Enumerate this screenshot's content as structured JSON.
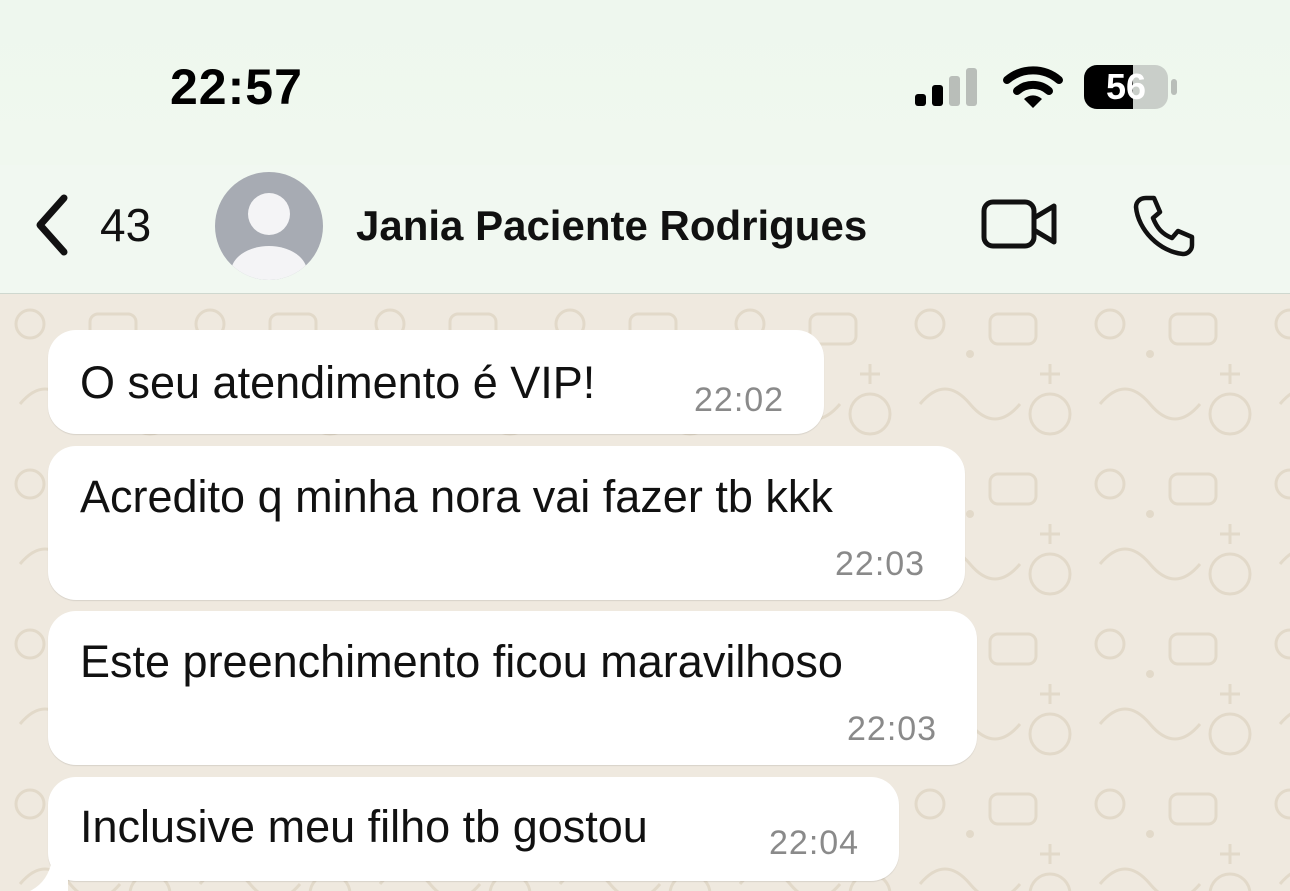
{
  "status_bar": {
    "time": "22:57",
    "battery_level": "56",
    "icons": [
      "cellular-signal-icon",
      "wifi-icon",
      "battery-icon"
    ]
  },
  "header": {
    "back_count": "43",
    "contact_name": "Jania Paciente Rodrigues",
    "icons": [
      "chevron-left-icon",
      "avatar-placeholder-icon",
      "video-camera-icon",
      "phone-icon"
    ]
  },
  "messages": [
    {
      "text": "O seu atendimento é VIP!",
      "time": "22:02"
    },
    {
      "text": "Acredito q minha nora vai fazer tb kkk",
      "time": "22:03"
    },
    {
      "text": "Este preenchimento ficou maravilhoso",
      "time": "22:03"
    },
    {
      "text": "Inclusive meu filho tb gostou",
      "time": "22:04"
    }
  ],
  "colors": {
    "header_bg": "#f1f8f1",
    "chat_bg": "#efe9df",
    "bubble_bg": "#ffffff",
    "timestamp": "#8a8a8a"
  }
}
